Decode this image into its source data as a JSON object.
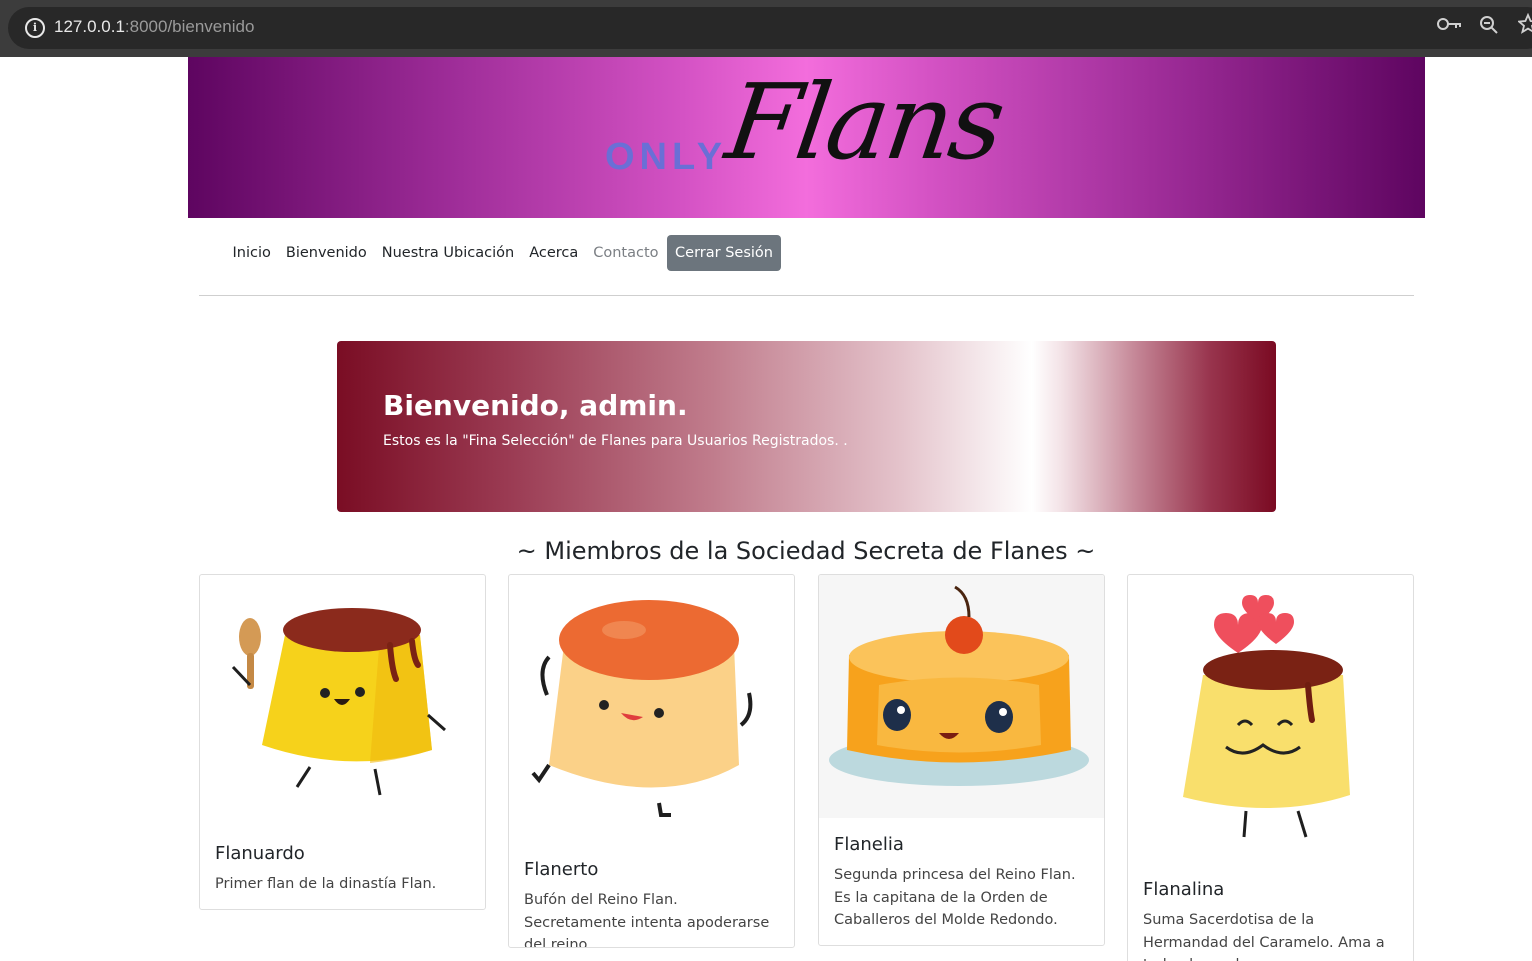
{
  "browser": {
    "url_host": "127.0.0.1",
    "url_port_path": ":8000/bienvenido"
  },
  "banner": {
    "logo_small": "ONLY",
    "logo_script": "Flans"
  },
  "nav": {
    "items": [
      "Inicio",
      "Bienvenido",
      "Nuestra Ubicación",
      "Acerca",
      "Contacto"
    ],
    "logout_label": "Cerrar Sesión"
  },
  "hero": {
    "title": "Bienvenido, admin.",
    "subtitle": "Estos es la \"Fina Selección\" de Flanes para Usuarios Registrados. ."
  },
  "section_title": "~ Miembros de la Sociedad Secreta de Flanes ~",
  "cards": [
    {
      "name": "Flanuardo",
      "description": "Primer flan de la dinastía Flan."
    },
    {
      "name": "Flanerto",
      "description": "Bufón del Reino Flan. Secretamente intenta apoderarse del reino."
    },
    {
      "name": "Flanelia",
      "description": "Segunda princesa del Reino Flan. Es la capitana de la Orden de Caballeros del Molde Redondo."
    },
    {
      "name": "Flanalina",
      "description": "Suma Sacerdotisa de la Hermandad del Caramelo. Ama a todo el mundo."
    }
  ],
  "colors": {
    "banner_center": "#f36ddc",
    "banner_edge": "#5e0560",
    "hero_edge": "#7a0d24",
    "logout_button": "#6c757d"
  }
}
